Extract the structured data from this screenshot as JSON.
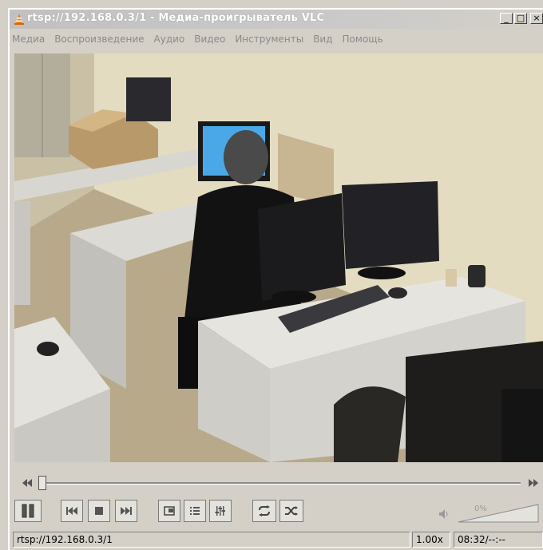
{
  "window": {
    "title": "rtsp://192.168.0.3/1 - Медиа-проигрыватель VLC",
    "buttons": [
      "_",
      "□",
      "×"
    ]
  },
  "menu": [
    "Медиа",
    "Воспроизведение",
    "Аудио",
    "Видео",
    "Инструменты",
    "Вид",
    "Помощь"
  ],
  "video": {
    "description": "office camera stream"
  },
  "seek": {
    "position": 0.0
  },
  "controls": {
    "buttons": [
      "pause-icon",
      "previous-icon",
      "stop-icon",
      "next-icon",
      "fullscreen-icon",
      "playlist-icon",
      "equalizer-icon",
      "loop-icon",
      "shuffle-icon"
    ],
    "volume_label": "0%",
    "volume_level": 0.0
  },
  "status": {
    "url": "rtsp://192.168.0.3/1",
    "speed": "1.00x",
    "time": "08:32/--:--"
  },
  "colors": {
    "accent": "#cc6600",
    "window_bg": "#d4d0c8"
  }
}
